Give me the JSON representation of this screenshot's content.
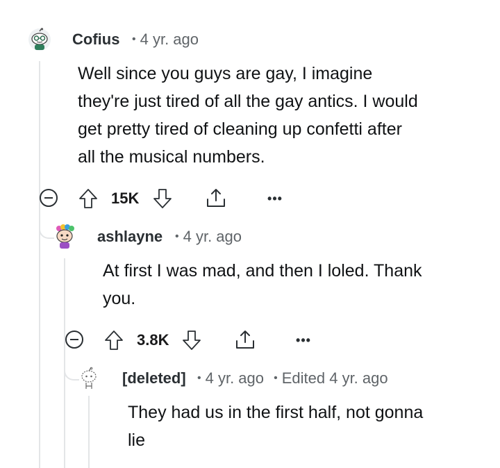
{
  "comments": [
    {
      "author": "Cofius",
      "time": "4 yr. ago",
      "body_lines": [
        "Well since you guys are gay, I imagine",
        "they're just tired of all the gay antics. I would",
        "get pretty tired of cleaning up confetti after",
        "all the musical numbers."
      ],
      "score": "15K",
      "avatar_icon": "snoo-glasses-avatar-icon"
    },
    {
      "author": "ashlayne",
      "time": "4 yr. ago",
      "body_lines": [
        "At first I was mad, and then I loled. Thank",
        "you."
      ],
      "score": "3.8K",
      "avatar_icon": "snoo-rainbow-hair-avatar-icon"
    },
    {
      "author": "[deleted]",
      "time": "4 yr. ago",
      "edited": "Edited 4 yr. ago",
      "body_lines": [
        "They had us in the first half, not gonna",
        "lie"
      ],
      "avatar_icon": "deleted-user-avatar-icon"
    }
  ],
  "actions": {
    "more_label": "•••"
  },
  "colors": {
    "thread_line": "#e3e5e7",
    "meta_text": "#5f6468",
    "author_text": "#2a2f33"
  }
}
